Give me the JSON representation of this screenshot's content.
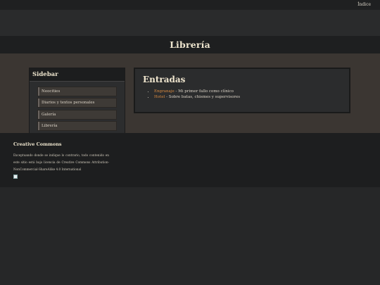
{
  "topbar": {
    "index_link": "Índice"
  },
  "header": {
    "title": "Librería"
  },
  "sidebar": {
    "title": "Sidebar",
    "items": [
      {
        "label": "Neocities"
      },
      {
        "label": "Diarios y textos personales"
      },
      {
        "label": "Galería"
      },
      {
        "label": "Librería"
      }
    ]
  },
  "main": {
    "title": "Entradas",
    "entries": [
      {
        "link": "Engranaje",
        "text": " - Mi primer fallo como clínico"
      },
      {
        "link": "Hotel",
        "text": " - Sobre batas, chismes y supervisores"
      }
    ]
  },
  "footer": {
    "title": "Creative Commons",
    "text": "Exceptuando donde se indique lo contrario, todo contenido en este sitio está bajo licencia de Creative Commons Attribution-NonCommercial-ShareAlike 4.0 International"
  }
}
